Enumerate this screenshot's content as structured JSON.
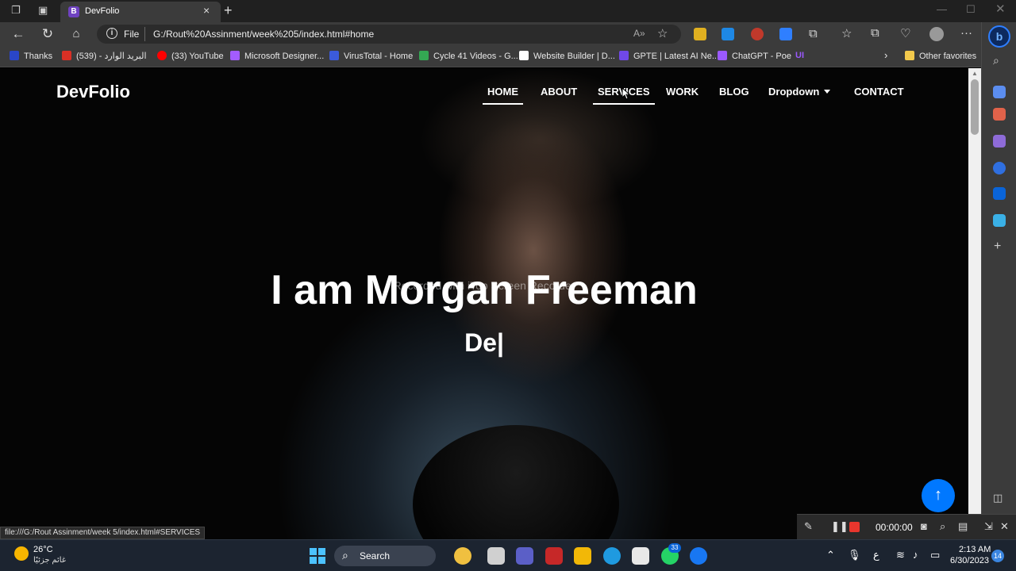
{
  "browser": {
    "tab_title": "DevFolio",
    "tab_favicon_letter": "B",
    "url_scheme": "File",
    "url": "G:/Rout%20Assinment/week%205/index.html#home",
    "bookmarks": [
      {
        "label": "Thanks",
        "color": "#2a46c8"
      },
      {
        "label": "(539) - البريد الوارد",
        "color": "#d93025"
      },
      {
        "label": "(33) YouTube",
        "color": "#ff0000"
      },
      {
        "label": "Microsoft Designer...",
        "color": "#a35cff"
      },
      {
        "label": "VirusTotal - Home",
        "color": "#3b5bdb"
      },
      {
        "label": "Cycle 41 Videos - G...",
        "color": "#34a853"
      },
      {
        "label": "Website Builder | D...",
        "color": "#ffffff"
      },
      {
        "label": "GPTE | Latest AI Ne...",
        "color": "#7048e8"
      },
      {
        "label": "ChatGPT - Poe",
        "color": "#9b59ff"
      }
    ],
    "other_favorites": "Other favorites",
    "status_url": "file:///G:/Rout Assinment/week 5/index.html#SERVICES"
  },
  "site": {
    "brand": "DevFolio",
    "nav": [
      "HOME",
      "ABOUT",
      "SERVICES",
      "WORK",
      "BLOG",
      "Dropdown",
      "CONTACT"
    ],
    "hero_title": "I am Morgan Freeman",
    "hero_typed": "De|",
    "watermark": "Recorded with iTop Screen Recorder",
    "scroll_top_icon": "arrow-up-icon"
  },
  "recorder": {
    "time": "00:00:00"
  },
  "taskbar": {
    "weather_temp": "26°C",
    "weather_desc": "غائم جزئيًا",
    "search_label": "Search",
    "whatsapp_badge": "33",
    "lang": "ع",
    "time": "2:13 AM",
    "date": "6/30/2023",
    "notifications": "14"
  },
  "colors": {
    "accent": "#0078ff",
    "record": "#e8362d",
    "taskbar": "#1c2430"
  }
}
